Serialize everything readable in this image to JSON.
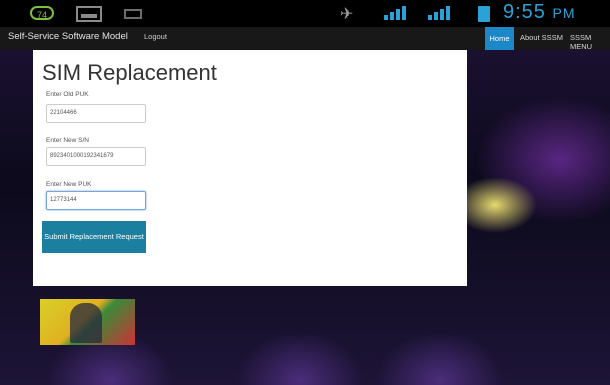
{
  "status_bar": {
    "usb_icon_text": "74",
    "time": "9:55",
    "ampm": "PM"
  },
  "navbar": {
    "brand": "Self-Service Software Model",
    "logout": "Logout",
    "items": [
      {
        "label": "Home"
      },
      {
        "label": "About SSSM"
      },
      {
        "label": "SSSM MENU"
      }
    ]
  },
  "form": {
    "title": "SIM Replacement",
    "old_puk_label": "Enter Old PUK",
    "old_puk_value": "22104466",
    "new_sn_label": "Enter New S/N",
    "new_sn_value": "8923401000192341679",
    "new_puk_label": "Enter New PUK",
    "new_puk_value": "12773144",
    "submit_label": "Submit Replacement Request"
  },
  "colors": {
    "accent": "#1d88c8",
    "button": "#1b7fa0",
    "status_blue": "#2aa1d7"
  }
}
